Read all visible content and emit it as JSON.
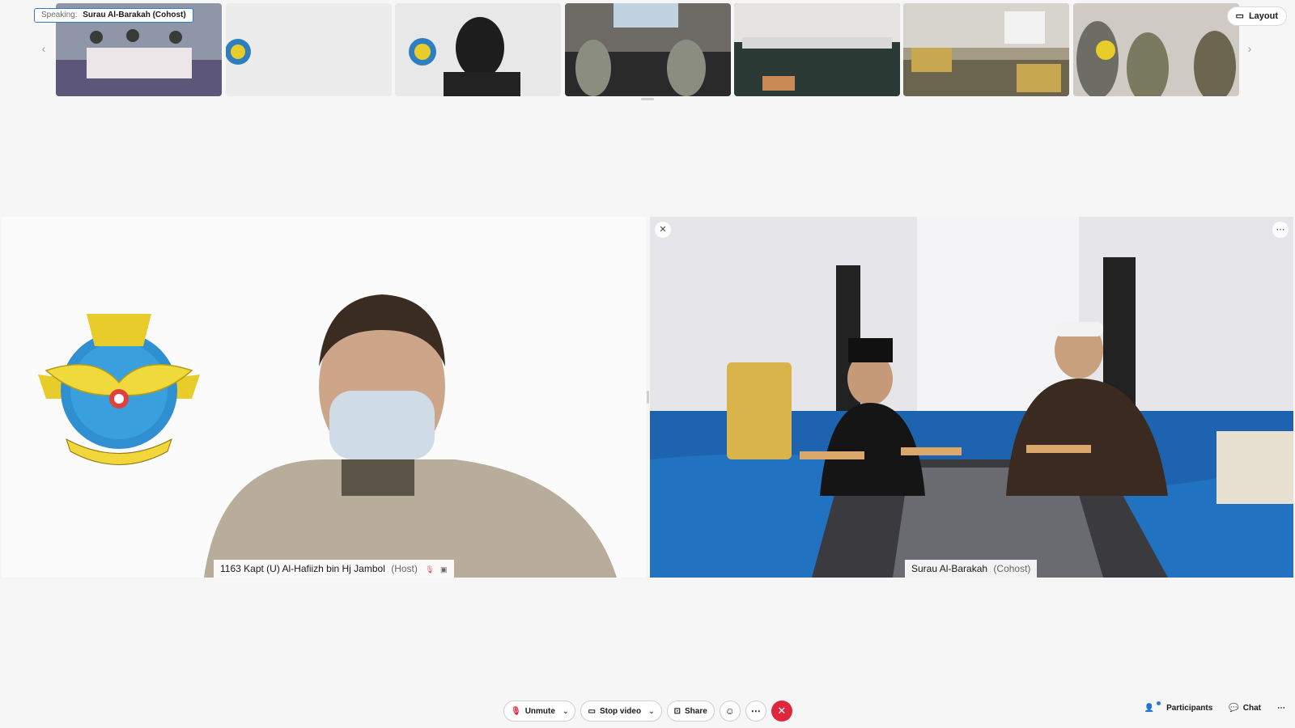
{
  "filmstrip": {
    "speaking_label": "Speaking:",
    "speaking_name": "Surau Al-Barakah (Cohost)",
    "layout_label": "Layout",
    "prev_icon": "chevron-left-icon",
    "next_icon": "chevron-right-icon"
  },
  "tiles": {
    "left": {
      "name": "1163 Kapt (U) Al-Hafiizh bin Hj Jambol",
      "role": "(Host)"
    },
    "right": {
      "name": "Surau Al-Barakah",
      "role": "(Cohost)"
    }
  },
  "toolbar": {
    "unmute_label": "Unmute",
    "stop_video_label": "Stop video",
    "share_label": "Share",
    "participants_label": "Participants",
    "chat_label": "Chat"
  },
  "colors": {
    "accent": "#2e7bd6",
    "end_call": "#e0263c",
    "background": "#f6f6f6"
  }
}
